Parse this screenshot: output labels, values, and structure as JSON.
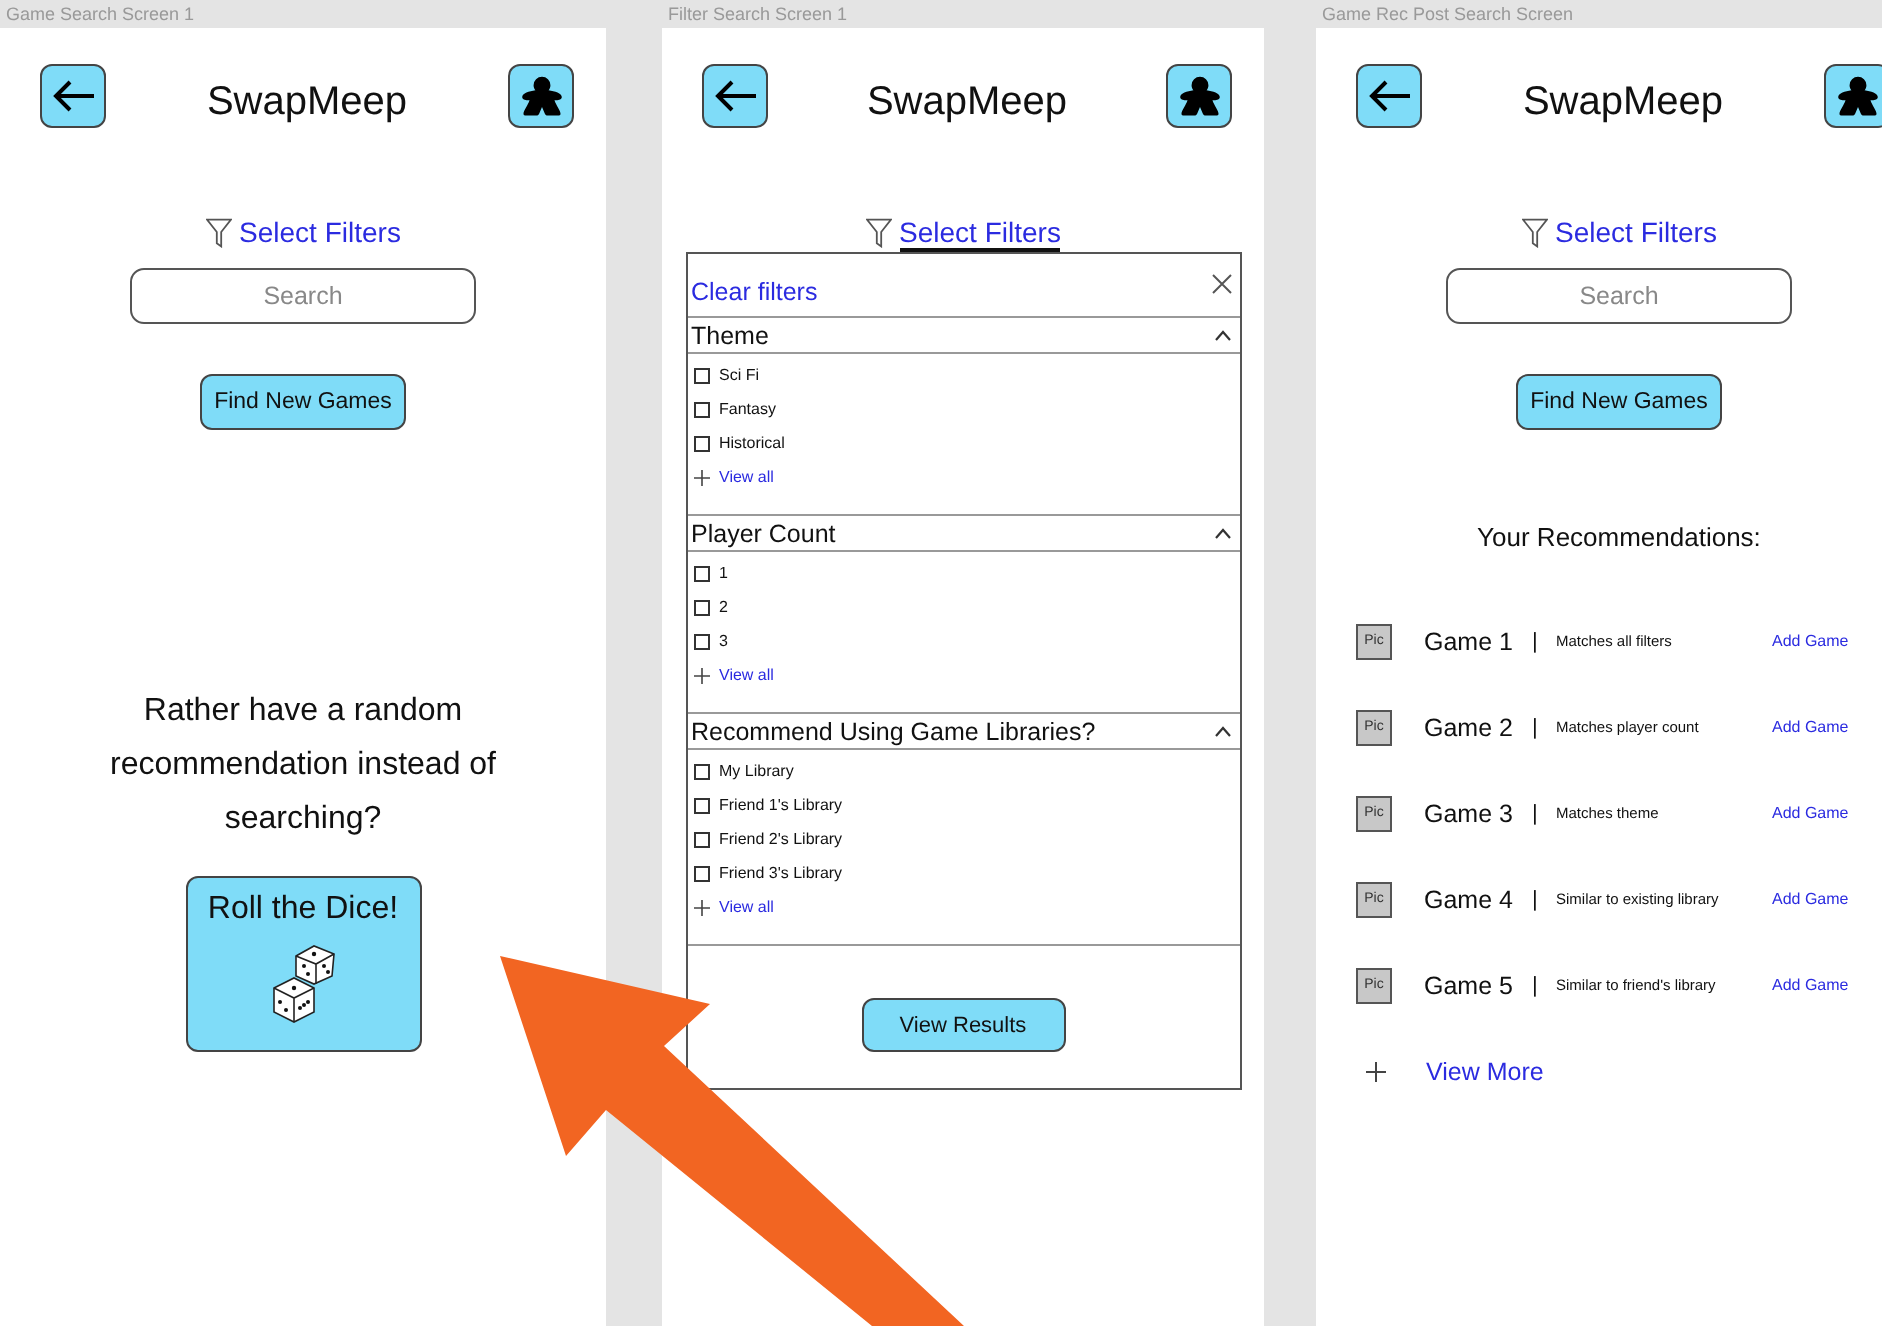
{
  "screens": [
    {
      "kind": "search",
      "label": "Game Search Screen 1",
      "title": "SwapMeep",
      "filter_link": {
        "label": "Select Filters",
        "selected": false
      },
      "search": {
        "placeholder": "Search"
      },
      "find_button": "Find New Games",
      "prompt": "Rather have a random recommendation instead of searching?",
      "roll_button": "Roll the Dice!"
    },
    {
      "kind": "filter",
      "label": "Filter Search Screen 1",
      "title": "SwapMeep",
      "filter_link": {
        "label": "Select Filters",
        "selected": true
      },
      "panel": {
        "clear": "Clear filters",
        "sections": [
          {
            "title": "Theme",
            "expanded": true,
            "options": [
              {
                "label": "Sci Fi",
                "checked": false
              },
              {
                "label": "Fantasy",
                "checked": false
              },
              {
                "label": "Historical",
                "checked": false
              }
            ],
            "view_all": "View all"
          },
          {
            "title": "Player Count",
            "expanded": true,
            "options": [
              {
                "label": "1",
                "checked": false
              },
              {
                "label": "2",
                "checked": false
              },
              {
                "label": "3",
                "checked": false
              }
            ],
            "view_all": "View all"
          },
          {
            "title": "Recommend Using Game Libraries?",
            "expanded": true,
            "options": [
              {
                "label": "My Library",
                "checked": false
              },
              {
                "label": "Friend 1's Library",
                "checked": false
              },
              {
                "label": "Friend 2's Library",
                "checked": false
              },
              {
                "label": "Friend 3's Library",
                "checked": false
              }
            ],
            "view_all": "View all"
          }
        ],
        "button": "View Results"
      }
    },
    {
      "kind": "results",
      "label": "Game Rec Post Search Screen",
      "title": "SwapMeep",
      "filter_link": {
        "label": "Select Filters",
        "selected": false
      },
      "search": {
        "placeholder": "Search"
      },
      "find_button": "Find New Games",
      "heading": "Your Recommendations:",
      "items": [
        {
          "pic": "Pic",
          "name": "Game 1",
          "separator": "|",
          "reason": "Matches all filters",
          "action": "Add Game"
        },
        {
          "pic": "Pic",
          "name": "Game 2",
          "separator": "|",
          "reason": "Matches player count",
          "action": "Add Game"
        },
        {
          "pic": "Pic",
          "name": "Game 3",
          "separator": "|",
          "reason": "Matches theme",
          "action": "Add Game"
        },
        {
          "pic": "Pic",
          "name": "Game 4",
          "separator": "|",
          "reason": "Similar to existing library",
          "action": "Add Game"
        },
        {
          "pic": "Pic",
          "name": "Game 5",
          "separator": "|",
          "reason": "Similar to friend's library",
          "action": "Add Game"
        }
      ],
      "more": "View More"
    }
  ]
}
